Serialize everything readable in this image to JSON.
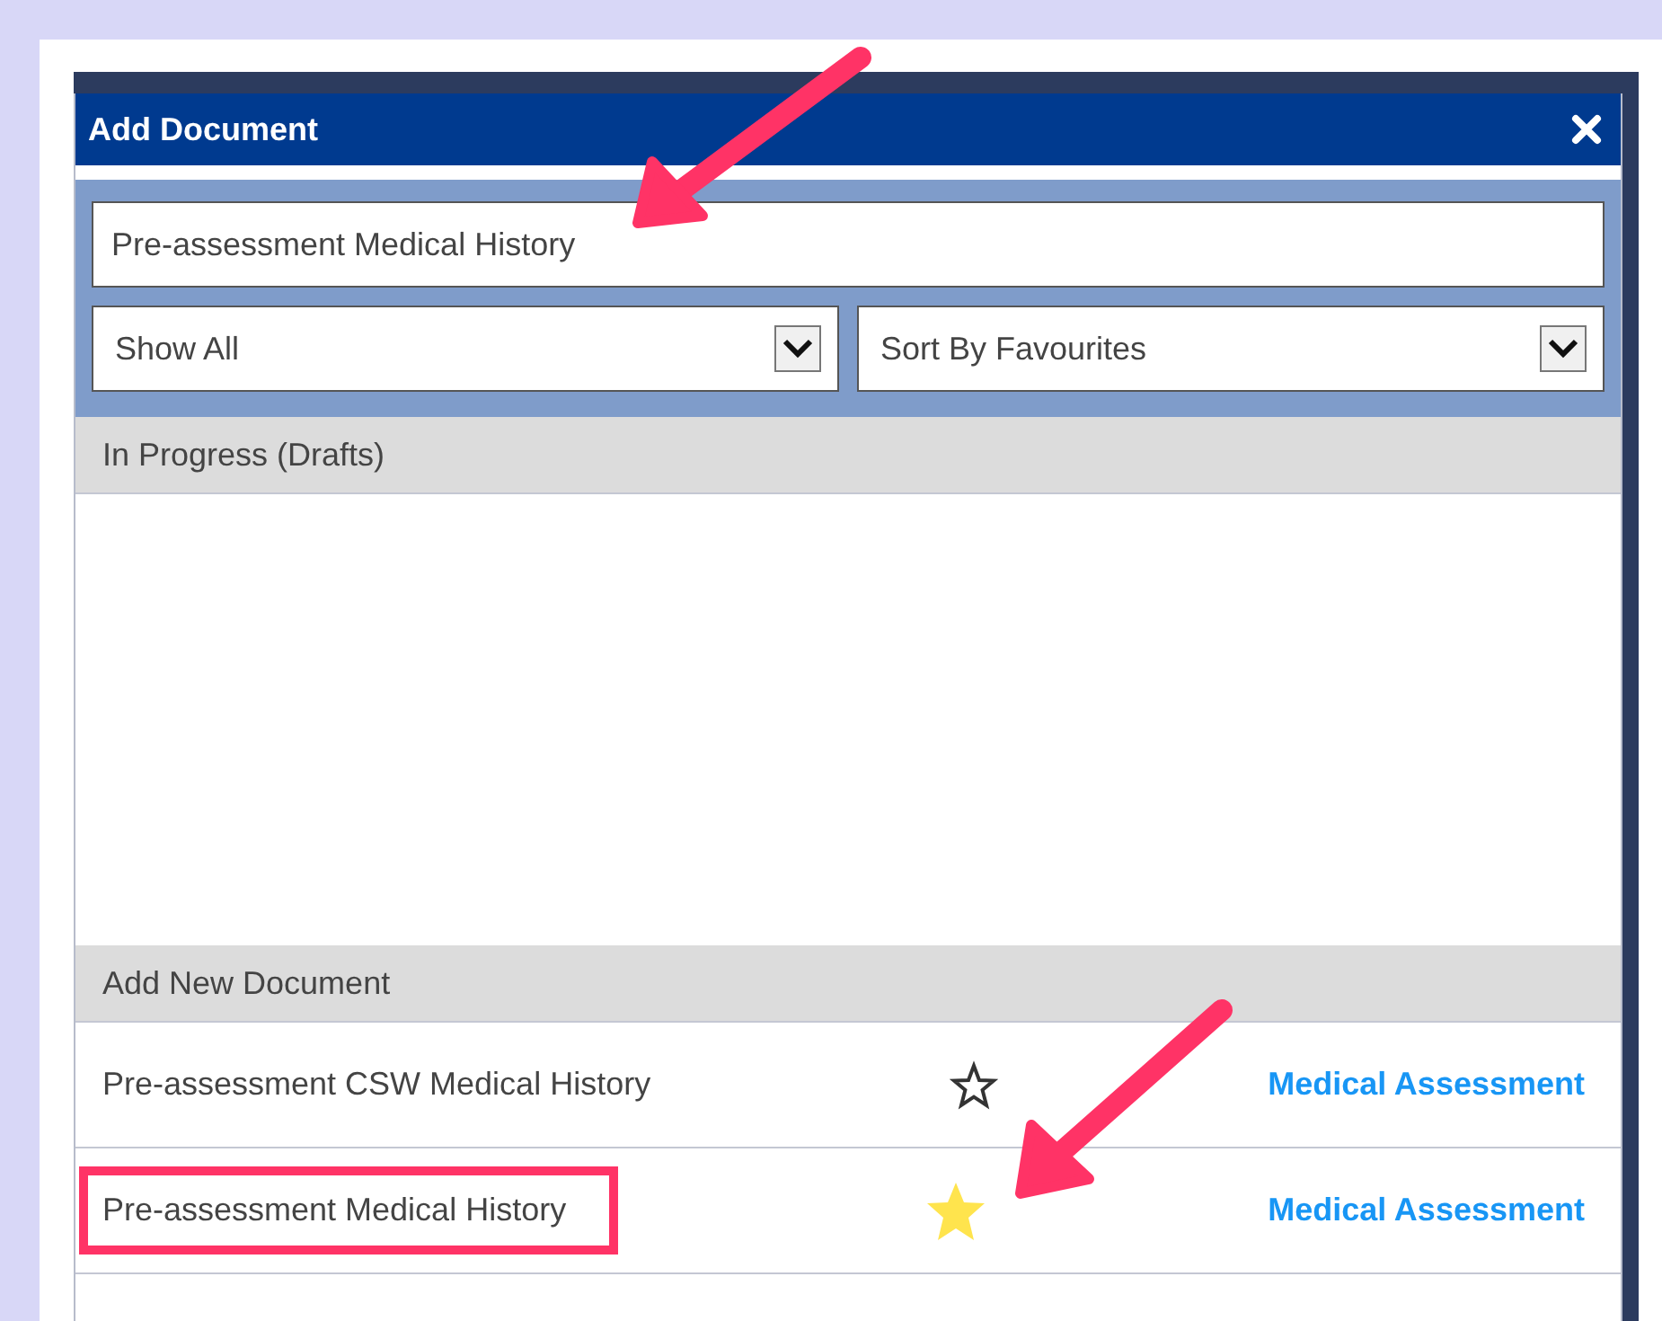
{
  "dialog": {
    "title": "Add Document"
  },
  "search": {
    "value": "Pre-assessment Medical History"
  },
  "filters": [
    {
      "value": "Show All"
    },
    {
      "value": "Sort By Favourites"
    }
  ],
  "sections": [
    {
      "title": "In Progress (Drafts)"
    },
    {
      "title": "Add New Document",
      "documents": [
        {
          "name": "Pre-assessment CSW Medical History",
          "favourite": false,
          "category": "Medical Assessment",
          "highlighted": false
        },
        {
          "name": "Pre-assessment Medical History",
          "favourite": true,
          "category": "Medical Assessment",
          "highlighted": true
        }
      ]
    }
  ]
}
